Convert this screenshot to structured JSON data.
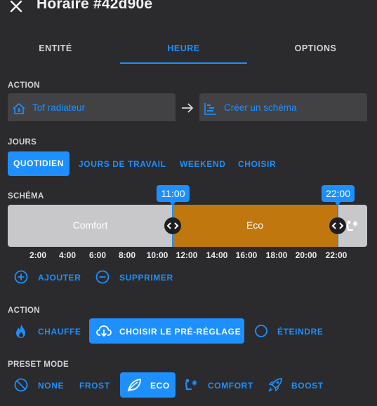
{
  "header": {
    "title": "Horaire #42d90e"
  },
  "tabs": [
    {
      "label": "ENTITÉ"
    },
    {
      "label": "HEURE"
    },
    {
      "label": "OPTIONS"
    }
  ],
  "action_section": {
    "label": "ACTION",
    "entity_field": {
      "value": "Tof radiateur",
      "icon": "thermostat-home-icon"
    },
    "arrow_icon": "arrow-right-icon",
    "schema_field": {
      "value": "Créer un schéma",
      "icon": "timeline-chart-icon"
    }
  },
  "days_section": {
    "label": "JOURS",
    "options": [
      "QUOTIDIEN",
      "JOURS DE TRAVAIL",
      "WEEKEND",
      "CHOISIR"
    ],
    "selected": "QUOTIDIEN"
  },
  "schema_section": {
    "label": "SCHÉMA",
    "segments": [
      {
        "label": "Comfort",
        "color": "#c8c7c9"
      },
      {
        "label": "Eco",
        "color": "#c0770e"
      },
      {
        "label": "",
        "color": "#c8c7c9",
        "icon": "comfort-snow-icon"
      }
    ],
    "markers": [
      "11:00",
      "22:00"
    ],
    "ticks": [
      "2:00",
      "4:00",
      "6:00",
      "8:00",
      "10:00",
      "12:00",
      "14:00",
      "16:00",
      "18:00",
      "20:00",
      "22:00"
    ],
    "add_label": "AJOUTER",
    "remove_label": "SUPPRIMER"
  },
  "action2_section": {
    "label": "ACTION",
    "heat_label": "CHAUFFE",
    "preset_label": "CHOISIR LE PRÉ-RÉGLAGE",
    "off_label": "ÉTEINDRE"
  },
  "preset_section": {
    "label": "PRESET MODE",
    "none_label": "NONE",
    "frost_label": "FROST",
    "eco_label": "ECO",
    "comfort_label": "COMFORT",
    "boost_label": "BOOST"
  },
  "colors": {
    "accent": "#1e8fff",
    "background": "#2b2b2d",
    "eco": "#c0770e",
    "comfort": "#c8c7c9"
  }
}
